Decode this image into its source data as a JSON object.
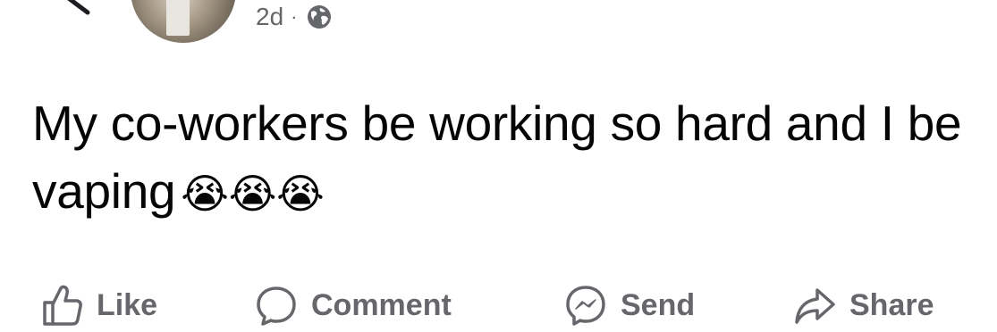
{
  "post": {
    "timestamp": "2d",
    "separator": "·",
    "privacy_icon": "globe-icon",
    "text": "My co-workers be working so hard and I be vaping",
    "emojis": "😭😭😭"
  },
  "actions": {
    "like": {
      "label": "Like",
      "icon": "thumbs-up-icon"
    },
    "comment": {
      "label": "Comment",
      "icon": "speech-bubble-icon"
    },
    "send": {
      "label": "Send",
      "icon": "messenger-icon"
    },
    "share": {
      "label": "Share",
      "icon": "share-arrow-icon"
    }
  },
  "colors": {
    "text": "#050505",
    "secondary": "#65676b",
    "background": "#ffffff"
  }
}
